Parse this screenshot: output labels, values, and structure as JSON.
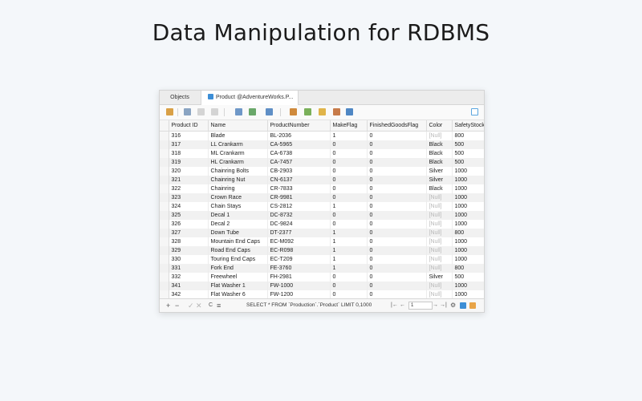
{
  "headline": "Data Manipulation for RDBMS",
  "tabs": [
    {
      "label": "Objects"
    },
    {
      "label": "Product @AdventureWorks.P..."
    }
  ],
  "columns": [
    "Product ID",
    "Name",
    "ProductNumber",
    "MakeFlag",
    "FinishedGoodsFlag",
    "Color",
    "SafetyStock"
  ],
  "rows": [
    [
      "316",
      "Blade",
      "BL-2036",
      "1",
      "0",
      "[Null]",
      "800"
    ],
    [
      "317",
      "LL Crankarm",
      "CA-5965",
      "0",
      "0",
      "Black",
      "500"
    ],
    [
      "318",
      "ML Crankarm",
      "CA-6738",
      "0",
      "0",
      "Black",
      "500"
    ],
    [
      "319",
      "HL Crankarm",
      "CA-7457",
      "0",
      "0",
      "Black",
      "500"
    ],
    [
      "320",
      "Chainring Bolts",
      "CB-2903",
      "0",
      "0",
      "Silver",
      "1000"
    ],
    [
      "321",
      "Chainring Nut",
      "CN-6137",
      "0",
      "0",
      "Silver",
      "1000"
    ],
    [
      "322",
      "Chainring",
      "CR-7833",
      "0",
      "0",
      "Black",
      "1000"
    ],
    [
      "323",
      "Crown Race",
      "CR-9981",
      "0",
      "0",
      "[Null]",
      "1000"
    ],
    [
      "324",
      "Chain Stays",
      "CS-2812",
      "1",
      "0",
      "[Null]",
      "1000"
    ],
    [
      "325",
      "Decal 1",
      "DC-8732",
      "0",
      "0",
      "[Null]",
      "1000"
    ],
    [
      "326",
      "Decal 2",
      "DC-9824",
      "0",
      "0",
      "[Null]",
      "1000"
    ],
    [
      "327",
      "Down Tube",
      "DT-2377",
      "1",
      "0",
      "[Null]",
      "800"
    ],
    [
      "328",
      "Mountain End Caps",
      "EC-M092",
      "1",
      "0",
      "[Null]",
      "1000"
    ],
    [
      "329",
      "Road End Caps",
      "EC-R098",
      "1",
      "0",
      "[Null]",
      "1000"
    ],
    [
      "330",
      "Touring End Caps",
      "EC-T209",
      "1",
      "0",
      "[Null]",
      "1000"
    ],
    [
      "331",
      "Fork End",
      "FE-3760",
      "1",
      "0",
      "[Null]",
      "800"
    ],
    [
      "332",
      "Freewheel",
      "FH-2981",
      "0",
      "0",
      "Silver",
      "500"
    ],
    [
      "341",
      "Flat Washer 1",
      "FW-1000",
      "0",
      "0",
      "[Null]",
      "1000"
    ],
    [
      "342",
      "Flat Washer 6",
      "FW-1200",
      "0",
      "0",
      "[Null]",
      "1000"
    ]
  ],
  "statusbar": {
    "add": "+",
    "remove": "−",
    "apply": "✓",
    "discard": "✕",
    "refresh": "C",
    "stop": "≡",
    "query": "SELECT * FROM `Production`.`Product` LIMIT 0,1000",
    "first": "|←",
    "prev": "←",
    "page": "1",
    "next": "→",
    "last": "→|",
    "settings": "⚙"
  },
  "colors": {
    "accent": "#3c8ed6",
    "null_text": "#b8b8b8",
    "row_stripe": "#f1f1f1"
  }
}
